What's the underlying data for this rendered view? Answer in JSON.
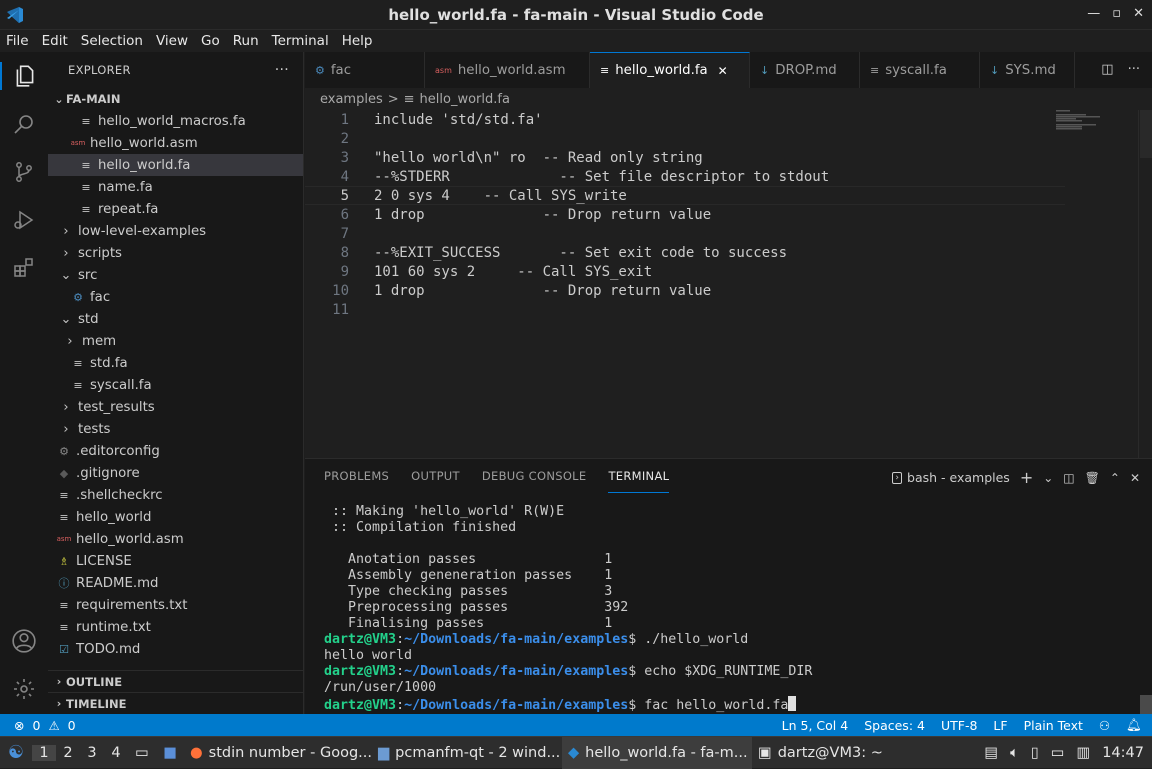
{
  "window": {
    "title": "hello_world.fa - fa-main - Visual Studio Code"
  },
  "menu": [
    "File",
    "Edit",
    "Selection",
    "View",
    "Go",
    "Run",
    "Terminal",
    "Help"
  ],
  "explorer": {
    "header": "EXPLORER",
    "project": "FA-MAIN",
    "items": [
      {
        "label": "hello_world_macros.fa",
        "icon": "≡"
      },
      {
        "label": "hello_world.asm",
        "icon": "asm"
      },
      {
        "label": "hello_world.fa",
        "icon": "≡"
      },
      {
        "label": "name.fa",
        "icon": "≡"
      },
      {
        "label": "repeat.fa",
        "icon": "≡"
      },
      {
        "label": "low-level-examples",
        "icon": ">"
      },
      {
        "label": "scripts",
        "icon": ">"
      },
      {
        "label": "src",
        "icon": "v"
      },
      {
        "label": "fac",
        "icon": "py"
      },
      {
        "label": "std",
        "icon": "v"
      },
      {
        "label": "mem",
        "icon": ">"
      },
      {
        "label": "std.fa",
        "icon": "≡"
      },
      {
        "label": "syscall.fa",
        "icon": "≡"
      },
      {
        "label": "test_results",
        "icon": ">"
      },
      {
        "label": "tests",
        "icon": ">"
      },
      {
        "label": ".editorconfig",
        "icon": "⚙"
      },
      {
        "label": ".gitignore",
        "icon": "◆"
      },
      {
        "label": ".shellcheckrc",
        "icon": "≡"
      },
      {
        "label": "hello_world",
        "icon": "≡"
      },
      {
        "label": "hello_world.asm",
        "icon": "asm"
      },
      {
        "label": "LICENSE",
        "icon": "lic"
      },
      {
        "label": "README.md",
        "icon": "ⓘ"
      },
      {
        "label": "requirements.txt",
        "icon": "≡"
      },
      {
        "label": "runtime.txt",
        "icon": "≡"
      },
      {
        "label": "TODO.md",
        "icon": "☑"
      }
    ],
    "outline": "OUTLINE",
    "timeline": "TIMELINE"
  },
  "tabs": [
    {
      "label": "fac",
      "icon": "py"
    },
    {
      "label": "hello_world.asm",
      "icon": "asm"
    },
    {
      "label": "hello_world.fa",
      "icon": "≡",
      "close": "✕"
    },
    {
      "label": "DROP.md",
      "icon": "↓"
    },
    {
      "label": "syscall.fa",
      "icon": "≡"
    },
    {
      "label": "SYS.md",
      "icon": "↓"
    }
  ],
  "breadcrumb": {
    "folder": "examples",
    "sep": ">",
    "file": "hello_world.fa"
  },
  "code": [
    {
      "n": "1",
      "text": "include 'std/std.fa'"
    },
    {
      "n": "2",
      "text": ""
    },
    {
      "n": "3",
      "text": "\"hello world\\n\" ro  -- Read only string"
    },
    {
      "n": "4",
      "text": "--%STDERR             -- Set file descriptor to stdout"
    },
    {
      "n": "5",
      "text": "2 0 sys 4    -- Call SYS_write"
    },
    {
      "n": "6",
      "text": "1 drop              -- Drop return value"
    },
    {
      "n": "7",
      "text": ""
    },
    {
      "n": "8",
      "text": "--%EXIT_SUCCESS       -- Set exit code to success"
    },
    {
      "n": "9",
      "text": "101 60 sys 2     -- Call SYS_exit"
    },
    {
      "n": "10",
      "text": "1 drop              -- Drop return value"
    },
    {
      "n": "11",
      "text": ""
    }
  ],
  "panel": {
    "tabs": [
      "PROBLEMS",
      "OUTPUT",
      "DEBUG CONSOLE",
      "TERMINAL"
    ],
    "terminal_name": "bash - examples",
    "lines": [
      " :: Making 'hello_world' R(W)E",
      " :: Compilation finished",
      "",
      "   Anotation passes                1",
      "   Assembly geneneration passes    1",
      "   Type checking passes            3",
      "   Preprocessing passes            392",
      "   Finalising passes               1"
    ],
    "prompt_user": "dartz@VM3",
    "prompt_path": "~/Downloads/fa-main/examples",
    "cmd1": "$ ./hello_world",
    "out1": "hello world",
    "cmd2": "$ echo $XDG_RUNTIME_DIR",
    "out2": "/run/user/1000",
    "cmd3": "$ fac hello_world.fa"
  },
  "status": {
    "errors": "0",
    "warnings": "0",
    "position": "Ln 5, Col 4",
    "spaces": "Spaces: 4",
    "encoding": "UTF-8",
    "eol": "LF",
    "language": "Plain Text"
  },
  "taskbar": {
    "workspaces": [
      "1",
      "2",
      "3",
      "4"
    ],
    "tasks": [
      "stdin number - Goog...",
      "pcmanfm-qt - 2 wind...",
      "hello_world.fa - fa-m...",
      "dartz@VM3: ~"
    ],
    "clock": "14:47"
  }
}
